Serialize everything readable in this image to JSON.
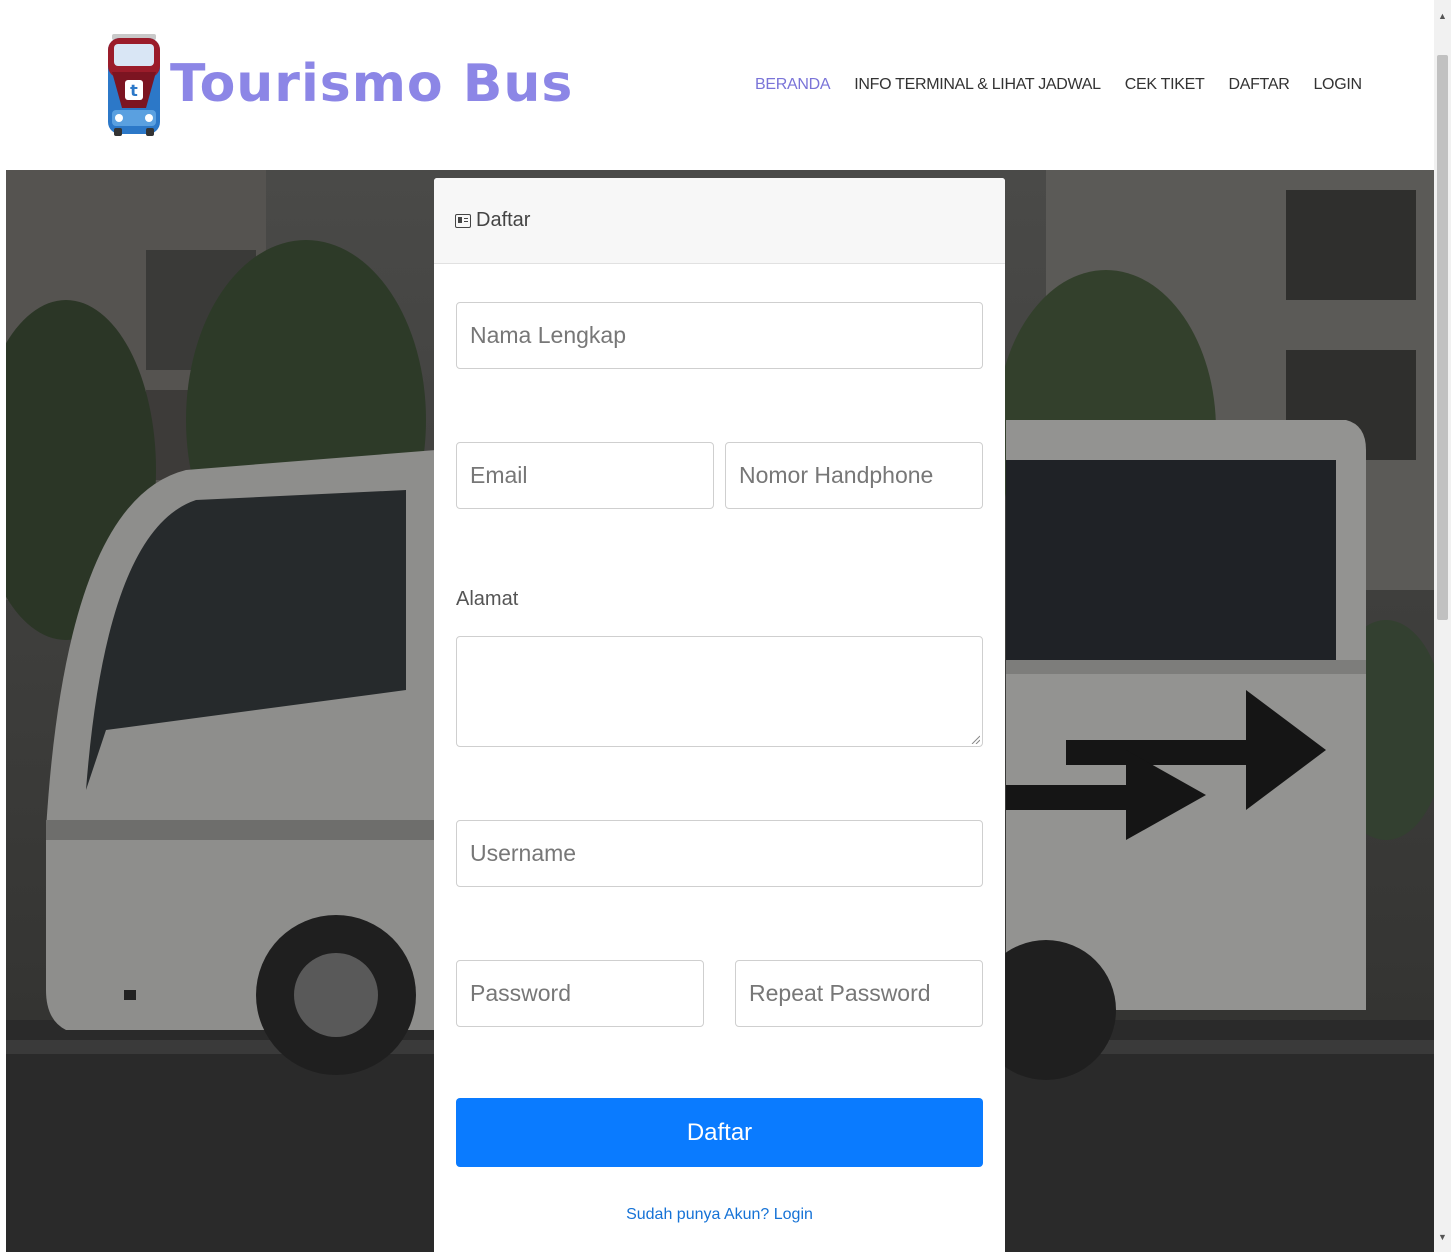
{
  "brand": {
    "name": "Tourismo Bus",
    "logo_icon": "bus-icon"
  },
  "nav": {
    "items": [
      {
        "label": "BERANDA",
        "active": true
      },
      {
        "label": "INFO TERMINAL & LIHAT JADWAL",
        "active": false
      },
      {
        "label": "CEK TIKET",
        "active": false
      },
      {
        "label": "DAFTAR",
        "active": false
      },
      {
        "label": "LOGIN",
        "active": false
      }
    ]
  },
  "form": {
    "header_title": "Daftar",
    "header_icon": "id-card-icon",
    "fields": {
      "nama_placeholder": "Nama Lengkap",
      "email_placeholder": "Email",
      "phone_placeholder": "Nomor Handphone",
      "alamat_label": "Alamat",
      "username_placeholder": "Username",
      "password_placeholder": "Password",
      "repeat_password_placeholder": "Repeat Password"
    },
    "submit_label": "Daftar",
    "login_link": "Sudah punya Akun? Login"
  },
  "colors": {
    "brand": "#8c86e6",
    "nav_active": "#7a74d8",
    "primary_button": "#0a7bff",
    "link": "#1572d6"
  }
}
